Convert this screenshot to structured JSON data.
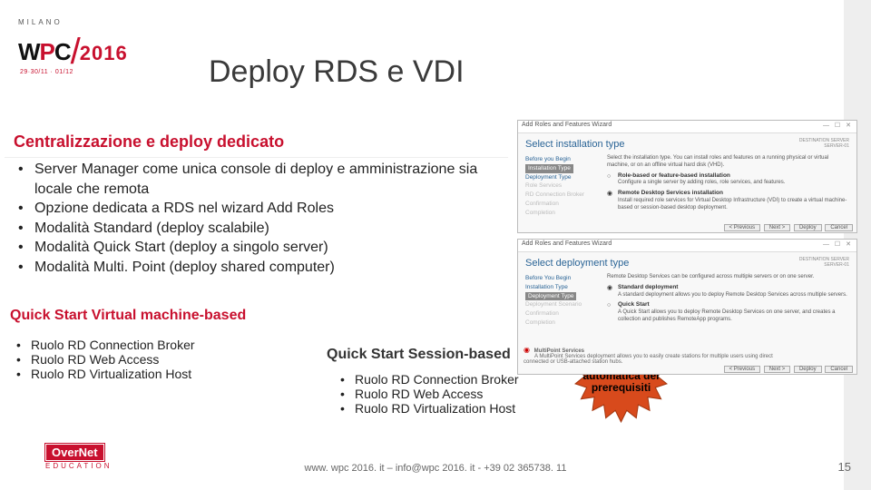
{
  "logo": {
    "top": "MILANO",
    "brand_pre": "W",
    "brand_mid": "P",
    "brand_post": "C",
    "slash": "/",
    "year": "2016",
    "dates": "29·30/11 · 01/12"
  },
  "title": "Deploy RDS e VDI",
  "heading1": "Centralizzazione e deploy dedicato",
  "bullets": [
    "Server Manager come unica console di deploy e amministrazione sia locale che remota",
    "Opzione dedicata a RDS nel wizard Add Roles",
    "Modalità Standard (deploy scalabile)",
    "Modalità Quick Start (deploy a singolo server)",
    "Modalità Multi. Point (deploy shared computer)"
  ],
  "heading2": "Quick Start Virtual machine-based",
  "col_left": [
    "Ruolo RD Connection Broker",
    "Ruolo RD Web Access",
    "Ruolo RD Virtualization Host"
  ],
  "heading3": "Quick Start Session-based",
  "col_right": [
    "Ruolo RD Connection Broker",
    "Ruolo RD Web Access",
    "Ruolo RD Virtualization Host"
  ],
  "starburst": "Verifica automatica dei prerequisiti",
  "wizard1": {
    "titlebar": "Add Roles and Features Wizard",
    "header": "Select installation type",
    "dest_label": "DESTINATION SERVER",
    "dest_value": "SERVER-01",
    "steps": [
      "Before you Begin",
      "Installation Type",
      "Deployment Type",
      "Role Services",
      "RD Connection Broker",
      "...",
      "Confirmation",
      "Completion"
    ],
    "intro": "Select the installation type. You can install roles and features on a running physical or virtual machine, or on an offline virtual hard disk (VHD).",
    "opt1_title": "Role-based or feature-based installation",
    "opt1_body": "Configure a single server by adding roles, role services, and features.",
    "opt2_title": "Remote Desktop Services installation",
    "opt2_body": "Install required role services for Virtual Desktop Infrastructure (VDI) to create a virtual machine-based or session-based desktop deployment.",
    "buttons": [
      "< Previous",
      "Next >",
      "Deploy",
      "Cancel"
    ]
  },
  "wizard2": {
    "titlebar": "Add Roles and Features Wizard",
    "header": "Select deployment type",
    "dest_label": "DESTINATION SERVER",
    "dest_value": "SERVER-01",
    "steps": [
      "Before You Begin",
      "Installation Type",
      "Deployment Type",
      "Deployment Scenario",
      "...",
      "Confirmation",
      "Completion"
    ],
    "intro": "Remote Desktop Services can be configured across multiple servers or on one server.",
    "opt1_title": "Standard deployment",
    "opt1_body": "A standard deployment allows you to deploy Remote Desktop Services across multiple servers.",
    "opt2_title": "Quick Start",
    "opt2_body": "A Quick Start allows you to deploy Remote Desktop Services on one server, and creates a collection and publishes RemoteApp programs.",
    "mp_title": "MultiPoint Services",
    "mp_body": "A MultiPoint Services deployment allows you to easily create stations for multiple users using direct connected or USB-attached station hubs.",
    "buttons": [
      "< Previous",
      "Next >",
      "Deploy",
      "Cancel"
    ]
  },
  "footer": {
    "overnet": "OverNet",
    "overnet_edu": "EDUCATION",
    "text": "www. wpc 2016. it – info@wpc 2016. it - +39 02 365738. 11",
    "page": "15"
  }
}
